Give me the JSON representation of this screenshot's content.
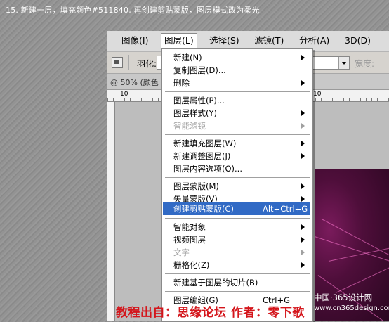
{
  "caption": "15. 新建一层，填充颜色#511840, 再创建剪贴蒙版，图层模式改为柔光",
  "menubar": [
    {
      "label": "图像(I)",
      "active": false
    },
    {
      "label": "图层(L)",
      "active": true
    },
    {
      "label": "选择(S)",
      "active": false
    },
    {
      "label": "滤镜(T)",
      "active": false
    },
    {
      "label": "分析(A)",
      "active": false
    },
    {
      "label": "3D(D)",
      "active": false
    }
  ],
  "options_bar": {
    "feather_label": "羽化:",
    "width_label": "宽度:"
  },
  "document": {
    "tab_label": "@ 50% (颜色",
    "ruler_tick_left": "10",
    "ruler_tick_right": "10"
  },
  "layer_menu": {
    "items": [
      {
        "label": "新建(N)",
        "shortcut": "",
        "submenu": true,
        "disabled": false,
        "highlight": false
      },
      {
        "label": "复制图层(D)...",
        "shortcut": "",
        "submenu": false,
        "disabled": false,
        "highlight": false
      },
      {
        "label": "删除",
        "shortcut": "",
        "submenu": true,
        "disabled": false,
        "highlight": false
      },
      {
        "label": "图层属性(P)...",
        "shortcut": "",
        "submenu": false,
        "disabled": false,
        "highlight": false
      },
      {
        "label": "图层样式(Y)",
        "shortcut": "",
        "submenu": true,
        "disabled": false,
        "highlight": false
      },
      {
        "label": "智能滤镜",
        "shortcut": "",
        "submenu": true,
        "disabled": true,
        "highlight": false
      },
      {
        "label": "新建填充图层(W)",
        "shortcut": "",
        "submenu": true,
        "disabled": false,
        "highlight": false
      },
      {
        "label": "新建调整图层(J)",
        "shortcut": "",
        "submenu": true,
        "disabled": false,
        "highlight": false
      },
      {
        "label": "图层内容选项(O)...",
        "shortcut": "",
        "submenu": false,
        "disabled": false,
        "highlight": false
      },
      {
        "label": "图层蒙版(M)",
        "shortcut": "",
        "submenu": true,
        "disabled": false,
        "highlight": false
      },
      {
        "label": "矢量蒙版(V)",
        "shortcut": "",
        "submenu": true,
        "disabled": false,
        "highlight": false
      },
      {
        "label": "创建剪贴蒙版(C)",
        "shortcut": "Alt+Ctrl+G",
        "submenu": false,
        "disabled": false,
        "highlight": true
      },
      {
        "label": "智能对象",
        "shortcut": "",
        "submenu": true,
        "disabled": false,
        "highlight": false
      },
      {
        "label": "视频图层",
        "shortcut": "",
        "submenu": true,
        "disabled": false,
        "highlight": false
      },
      {
        "label": "文字",
        "shortcut": "",
        "submenu": true,
        "disabled": true,
        "highlight": false
      },
      {
        "label": "栅格化(Z)",
        "shortcut": "",
        "submenu": true,
        "disabled": false,
        "highlight": false
      },
      {
        "label": "新建基于图层的切片(B)",
        "shortcut": "",
        "submenu": false,
        "disabled": false,
        "highlight": false
      },
      {
        "label": "图层编组(G)",
        "shortcut": "Ctrl+G",
        "submenu": false,
        "disabled": false,
        "highlight": false
      }
    ]
  },
  "footer_caption": "教程出自：思缘论坛    作者：零下歌",
  "watermark": {
    "line1": "中国·365设计网",
    "line2": "www.cn365design.com"
  },
  "colors": {
    "highlight": "#316ac5",
    "caption_red": "#d4151b",
    "fill_color": "#511840"
  }
}
